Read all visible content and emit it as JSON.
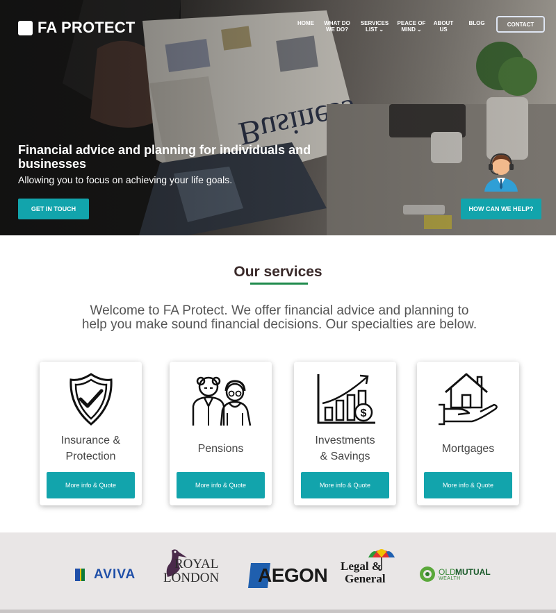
{
  "brand": {
    "name": "FA PROTECT"
  },
  "nav": {
    "home": "HOME",
    "what_do_we_do": [
      "WHAT DO",
      "WE DO?"
    ],
    "services_list": [
      "SERVICES",
      "LIST"
    ],
    "peace_of_mind": [
      "PEACE OF",
      "MIND"
    ],
    "about_us": [
      "ABOUT",
      "US"
    ],
    "blog": "BLOG",
    "contact": "CONTACT"
  },
  "hero": {
    "title": "Financial advice and planning for individuals and businesses",
    "subtitle": "Allowing you to focus on achieving your life goals.",
    "cta": "GET IN TOUCH",
    "help": "HOW CAN WE HELP?"
  },
  "services": {
    "title": "Our services",
    "intro": "Welcome to FA Protect. We offer financial advice and planning to help you make sound financial decisions. Our specialties are below.",
    "cards": [
      {
        "label_lines": [
          "Insurance &",
          "Protection"
        ],
        "icon": "shield-check-icon",
        "button": "More info & Quote"
      },
      {
        "label_lines": [
          "Pensions"
        ],
        "icon": "elderly-couple-icon",
        "button": "More info & Quote"
      },
      {
        "label_lines": [
          "Investments",
          "& Savings"
        ],
        "icon": "growth-chart-icon",
        "button": "More info & Quote"
      },
      {
        "label_lines": [
          "Mortgages"
        ],
        "icon": "house-hand-icon",
        "button": "More info & Quote"
      }
    ]
  },
  "partners": {
    "aviva": "AVIVA",
    "royal_london": [
      "ROYAL",
      "LONDON"
    ],
    "aegon": "AEGON",
    "legal_general": [
      "Legal &",
      "General"
    ],
    "old_mutual": [
      "OLD",
      "MUTUAL",
      "WEALTH"
    ]
  },
  "colors": {
    "teal": "#12a4ac",
    "green_underline": "#1f8a4c",
    "partner_band": "#e9e6e6"
  }
}
